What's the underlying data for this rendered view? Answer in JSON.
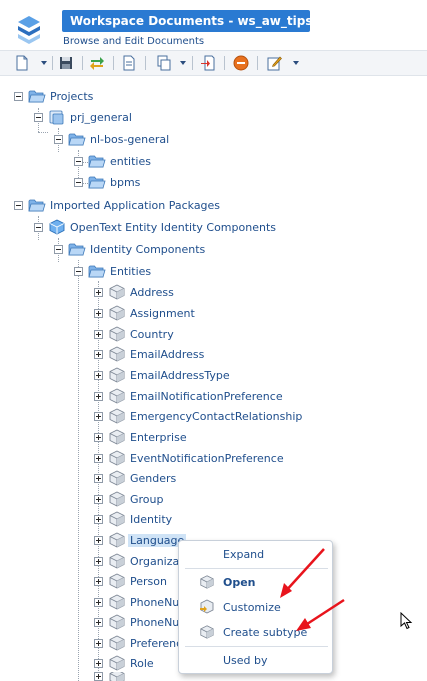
{
  "header": {
    "title": "Workspace Documents - ws_aw_tips",
    "subtitle": "Browse and Edit Documents"
  },
  "toolbar": {
    "icons": [
      "new-document-icon",
      "save-icon",
      "synchronize-icon",
      "document-icon",
      "copy-icon",
      "import-icon",
      "stop-icon",
      "edit-properties-icon"
    ]
  },
  "tree": {
    "projects": "Projects",
    "prj_general": "prj_general",
    "nl_bos_general": "nl-bos-general",
    "entities_folder": "entities",
    "bpms_folder": "bpms",
    "imported": "Imported Application Packages",
    "opentext": "OpenText Entity Identity Components",
    "identity_components": "Identity Components",
    "entities": "Entities",
    "items": [
      "Address",
      "Assignment",
      "Country",
      "EmailAddress",
      "EmailAddressType",
      "EmailNotificationPreference",
      "EmergencyContactRelationship",
      "Enterprise",
      "EventNotificationPreference",
      "Genders",
      "Group",
      "Identity",
      "Language",
      "Organiza",
      "Person",
      "PhoneNu",
      "PhoneNu",
      "Preferenc",
      "Role"
    ]
  },
  "context_menu": {
    "expand": "Expand",
    "open": "Open",
    "customize": "Customize",
    "create_subtype": "Create subtype",
    "used_by": "Used by"
  },
  "colors": {
    "title_bar": "#2a7ad2",
    "link_text": "#1f4e8c",
    "selection": "#cfe3f6",
    "annotation_arrow": "#e8141c"
  }
}
